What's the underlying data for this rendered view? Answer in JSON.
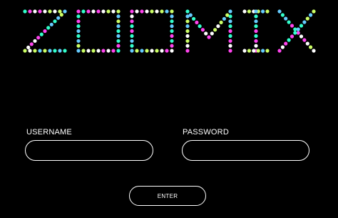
{
  "logo": {
    "text": "ZOOMIX",
    "dot_colors": [
      "#33ffcc",
      "#ccff66",
      "#ff44ee",
      "#66ccff",
      "#ffffff"
    ]
  },
  "login_form": {
    "username_label": "USERNAME",
    "username_value": "",
    "username_placeholder": "",
    "password_label": "PASSWORD",
    "password_value": "",
    "password_placeholder": "",
    "enter_label": "ENTER"
  },
  "colors": {
    "background": "#000000",
    "foreground": "#ffffff"
  }
}
